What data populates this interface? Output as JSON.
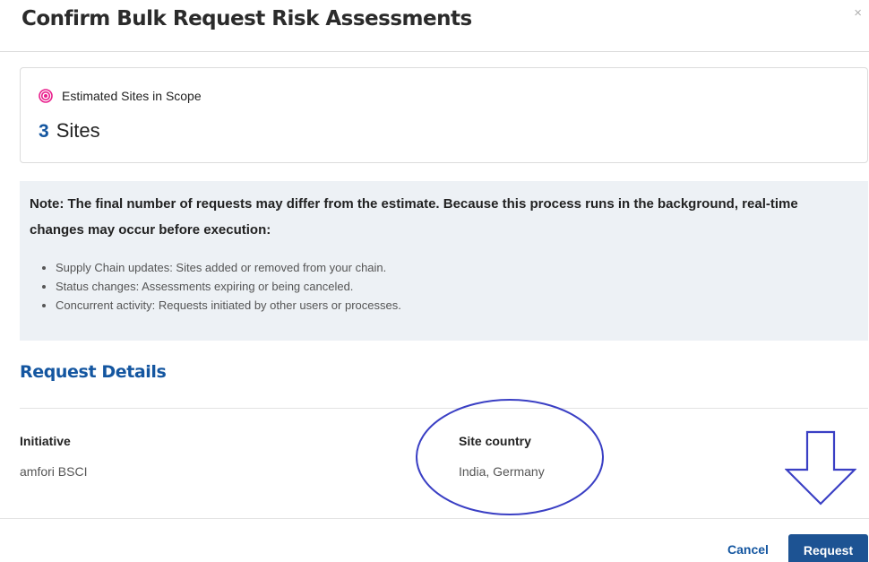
{
  "modal": {
    "title": "Confirm Bulk Request Risk Assessments",
    "close_symbol": "×"
  },
  "scope": {
    "icon": "target-icon",
    "label": "Estimated Sites in Scope",
    "count": "3",
    "unit": "Sites"
  },
  "note": {
    "text": "Note: The final number of requests may differ from the estimate. Because this process runs in the background, real-time changes may occur before execution:",
    "items": [
      "Supply Chain updates: Sites added or removed from your chain.",
      "Status changes: Assessments expiring or being canceled.",
      "Concurrent activity: Requests initiated by other users or processes."
    ]
  },
  "details": {
    "title": "Request Details",
    "initiative_label": "Initiative",
    "initiative_value": "amfori BSCI",
    "country_label": "Site country",
    "country_value": "India, Germany"
  },
  "footer": {
    "cancel_label": "Cancel",
    "request_label": "Request"
  },
  "colors": {
    "brand_blue": "#1456a0",
    "button_blue": "#1d5393",
    "note_bg": "#edf1f5",
    "icon_pink": "#e91e8c",
    "annotation": "#3a3fc4"
  }
}
